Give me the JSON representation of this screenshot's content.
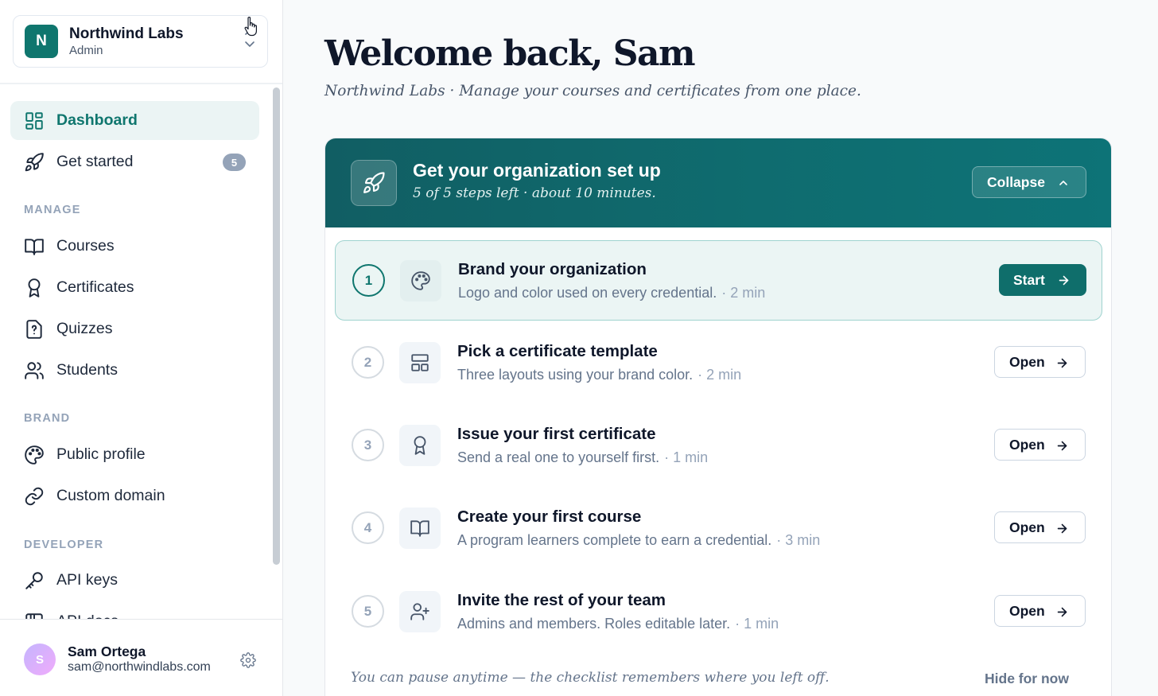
{
  "org": {
    "initial": "N",
    "name": "Northwind Labs",
    "role": "Admin"
  },
  "sidebar": {
    "items": [
      {
        "label": "Dashboard",
        "icon": "dashboard-icon",
        "active": true
      },
      {
        "label": "Get started",
        "icon": "rocket-icon",
        "badge": "5"
      }
    ],
    "sections": [
      {
        "title": "MANAGE",
        "items": [
          {
            "label": "Courses",
            "icon": "book-icon"
          },
          {
            "label": "Certificates",
            "icon": "award-icon"
          },
          {
            "label": "Quizzes",
            "icon": "quiz-icon"
          },
          {
            "label": "Students",
            "icon": "users-icon"
          }
        ]
      },
      {
        "title": "BRAND",
        "items": [
          {
            "label": "Public profile",
            "icon": "palette-icon"
          },
          {
            "label": "Custom domain",
            "icon": "link-icon"
          }
        ]
      },
      {
        "title": "DEVELOPER",
        "items": [
          {
            "label": "API keys",
            "icon": "key-icon"
          },
          {
            "label": "API docs",
            "icon": "docs-icon"
          }
        ]
      }
    ]
  },
  "user": {
    "initial": "S",
    "name": "Sam Ortega",
    "email": "sam@northwindlabs.com"
  },
  "main": {
    "title": "Welcome back, Sam",
    "subtitle": "Northwind Labs · Manage your courses and certificates from one place."
  },
  "setup": {
    "title": "Get your organization set up",
    "subtitle": "5 of 5 steps left · about 10 minutes.",
    "collapse_label": "Collapse",
    "steps": [
      {
        "num": "1",
        "title": "Brand your organization",
        "desc": "Logo and color used on every credential.",
        "time": "· 2 min",
        "button": "Start",
        "icon": "palette-icon",
        "active": true
      },
      {
        "num": "2",
        "title": "Pick a certificate template",
        "desc": "Three layouts using your brand color.",
        "time": "· 2 min",
        "button": "Open",
        "icon": "layout-icon"
      },
      {
        "num": "3",
        "title": "Issue your first certificate",
        "desc": "Send a real one to yourself first.",
        "time": "· 1 min",
        "button": "Open",
        "icon": "award-icon"
      },
      {
        "num": "4",
        "title": "Create your first course",
        "desc": "A program learners complete to earn a credential.",
        "time": "· 3 min",
        "button": "Open",
        "icon": "book-icon"
      },
      {
        "num": "5",
        "title": "Invite the rest of your team",
        "desc": "Admins and members. Roles editable later.",
        "time": "· 1 min",
        "button": "Open",
        "icon": "user-plus-icon"
      }
    ],
    "footer_note": "You can pause anytime — the checklist remembers where you left off.",
    "hide_label": "Hide for now"
  },
  "colors": {
    "brand": "#0f766e",
    "header_bg": "#0f6c6f"
  }
}
